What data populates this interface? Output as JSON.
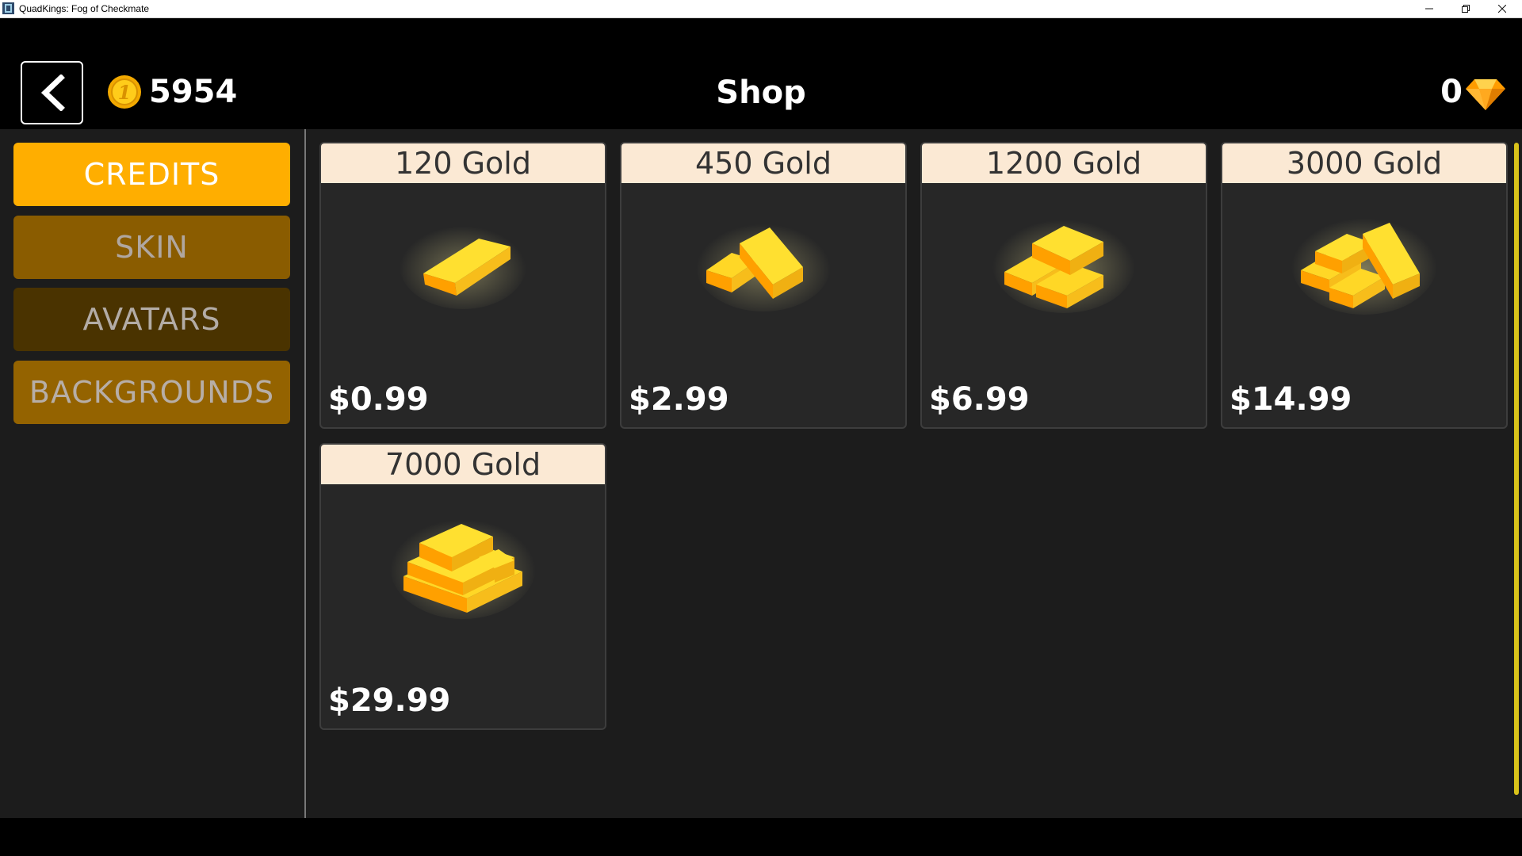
{
  "window": {
    "title": "QuadKings: Fog of Checkmate",
    "app_icon": "chess-app-icon",
    "controls": [
      "minimize-icon",
      "restore-icon",
      "close-icon"
    ]
  },
  "header": {
    "back_icon": "chevron-left-icon",
    "coins": "5954",
    "coin_icon": "gold-coin-icon",
    "title": "Shop",
    "gems": "0",
    "gem_icon": "diamond-icon"
  },
  "categories": [
    {
      "label": "CREDITS",
      "active": true
    },
    {
      "label": "SKIN",
      "active": false
    },
    {
      "label": "AVATARS",
      "active": false
    },
    {
      "label": "BACKGROUNDS",
      "active": false
    }
  ],
  "products": [
    {
      "title": "120 Gold",
      "price": "$0.99",
      "icon": "gold-bar-icon"
    },
    {
      "title": "450 Gold",
      "price": "$2.99",
      "icon": "gold-bars-icon"
    },
    {
      "title": "1200 Gold",
      "price": "$6.99",
      "icon": "gold-bars-stack-icon"
    },
    {
      "title": "3000 Gold",
      "price": "$14.99",
      "icon": "gold-bars-pile-icon"
    },
    {
      "title": "7000 Gold",
      "price": "$29.99",
      "icon": "gold-bars-big-stack-icon"
    }
  ],
  "colors": {
    "accent": "#ffae00",
    "card_header": "#fbe9d4",
    "card_bg": "#272727",
    "scrollbar": "#d9c21a"
  }
}
